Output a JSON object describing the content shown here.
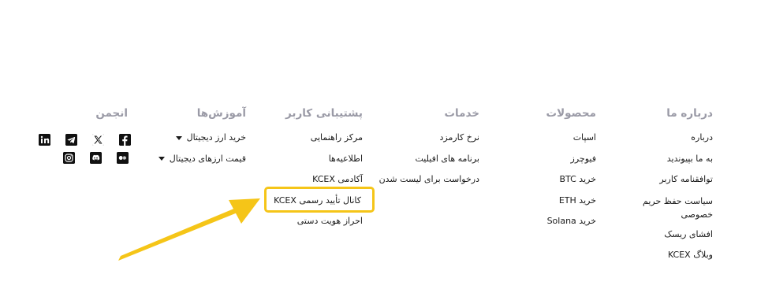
{
  "footer": {
    "about": {
      "heading": "درباره ما",
      "items": [
        "درباره",
        "به ما بپیوندید",
        "توافقنامه کاربر",
        "سیاست حفظ حریم خصوصی",
        "افشای ریسک",
        "وبلاگ KCEX"
      ]
    },
    "products": {
      "heading": "محصولات",
      "items": [
        "اسپات",
        "فیوچرز",
        "خرید BTC",
        "خرید ETH",
        "خرید Solana"
      ]
    },
    "services": {
      "heading": "خدمات",
      "items": [
        "نرخ کارمزد",
        "برنامه های افیلیت",
        "درخواست برای لیست شدن"
      ]
    },
    "support": {
      "heading": "پشتیبانی کاربر",
      "items": [
        "مرکز راهنمایی",
        "اطلاعیه‌ها",
        "آکادمی KCEX",
        "کانال تأیید رسمی KCEX",
        "احراز هویت دستی"
      ]
    },
    "learn": {
      "heading": "آموزش‌ها",
      "items": [
        "خرید ارز دیجیتال",
        "قیمت ارزهای دیجیتال"
      ]
    },
    "community": {
      "heading": "انجمن",
      "icons": [
        "facebook-icon",
        "x-twitter-icon",
        "telegram-icon",
        "linkedin-icon",
        "medium-icon",
        "discord-icon",
        "instagram-icon"
      ]
    }
  },
  "colors": {
    "highlight": "#f5c518",
    "heading": "#9a9aa6",
    "text": "#1a1a1a"
  }
}
